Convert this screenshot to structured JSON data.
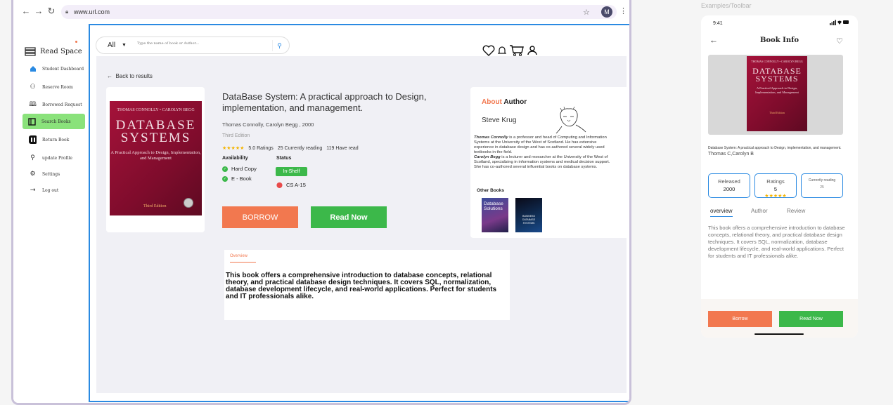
{
  "browser": {
    "url": "www.url.com",
    "avatar_letter": "M"
  },
  "sidebar": {
    "app_name": "Read Space",
    "items": [
      {
        "label": "Student Dashboard",
        "icon": "dashboard-icon"
      },
      {
        "label": "Reserve Room",
        "icon": "room-icon"
      },
      {
        "label": "Borrowed Request",
        "icon": "book-open-icon"
      },
      {
        "label": "Search Books",
        "icon": "search-books-icon"
      },
      {
        "label": "Return Book",
        "icon": "return-icon"
      },
      {
        "label": "update Profile",
        "icon": "user-icon"
      },
      {
        "label": "Settings",
        "icon": "gear-icon"
      },
      {
        "label": "Log out",
        "icon": "logout-icon"
      }
    ]
  },
  "search": {
    "filter": "All",
    "placeholder": "Type the name of book or Author..."
  },
  "back_label": "Back to results",
  "book": {
    "title": "DataBase System: A practical approach to Design, implementation, and management.",
    "authors": "Thomas Connolly, Carolyn Begg , 2000",
    "edition": "Third Edition",
    "rating": "5.0 Ratings",
    "reading": "25 Currently reading",
    "have_read": "119 Have read",
    "availability_label": "Availability",
    "status_label": "Status",
    "availability": [
      "Hard Copy",
      "E - Book"
    ],
    "status": "In-Shelf",
    "location": "CS A-15",
    "cover": {
      "author_line": "THOMAS CONNOLLY • CAROLYN BEGG",
      "title_line1": "DATABASE",
      "title_line2": "SYSTEMS",
      "subtitle": "A Practical Approach to Design, Implementation, and Management",
      "edition": "Third Edition"
    }
  },
  "buttons": {
    "borrow": "BORROW",
    "read_now": "Read Now"
  },
  "author": {
    "heading_accent": "About",
    "heading_rest": "Author",
    "name": "Steve Krug",
    "bio1_name": "Thomas Connolly",
    "bio1": " is a professor and head of Computing and Information Systems at the University of the West of Scotland. He has extensive experience in database design and has co-authored several widely used textbooks in the field.",
    "bio2_name": "Carolyn Begg",
    "bio2": " is a lecturer and researcher at the University of the West of Scotland, specializing in information systems and medical decision support. She has co-authored several influential books on database systems.",
    "other_books_label": "Other Books",
    "other_books": [
      {
        "title": "Database Solutions"
      },
      {
        "title": "BUSINESS DATABASE SYSTEMS"
      }
    ]
  },
  "overview": {
    "tab": "Overview",
    "text": "This book offers a comprehensive introduction to database concepts, relational theory, and practical database design techniques. It covers SQL, normalization, database development lifecycle, and real-world applications. Perfect for students and IT professionals alike."
  },
  "mobile": {
    "label": "Examples/Toolbar",
    "time": "9:41",
    "status_icons": ".Ⅱ ● ▬",
    "title": "Book Info",
    "description": "Database System: A practical approach to Design, implementation, and management.",
    "authors": "Thomas C,Carolyn B",
    "stats": [
      {
        "label": "Released",
        "value": "2000"
      },
      {
        "label": "Ratings",
        "value": "5"
      },
      {
        "label": "Currently reading",
        "value": "25"
      }
    ],
    "tabs": [
      "overview",
      "Author",
      "Review"
    ],
    "text": "This book offers a comprehensive introduction to database concepts, relational theory, and practical database design techniques. It covers SQL, normalization, database development lifecycle, and real-world applications. Perfect for students and IT professionals alike.",
    "borrow": "Borrow",
    "read_now": "Read Now",
    "cover": {
      "author_line": "THOMAS CONNOLLY • CAROLYN BEGG",
      "title_line1": "DATABASE",
      "title_line2": "SYSTEMS",
      "subtitle": "A Practical Approach to Design, Implementation, and Management",
      "edition": "Third Edition"
    }
  },
  "colors": {
    "accent": "#f2784f",
    "green": "#3cb84a",
    "blue": "#2a8ae2"
  }
}
